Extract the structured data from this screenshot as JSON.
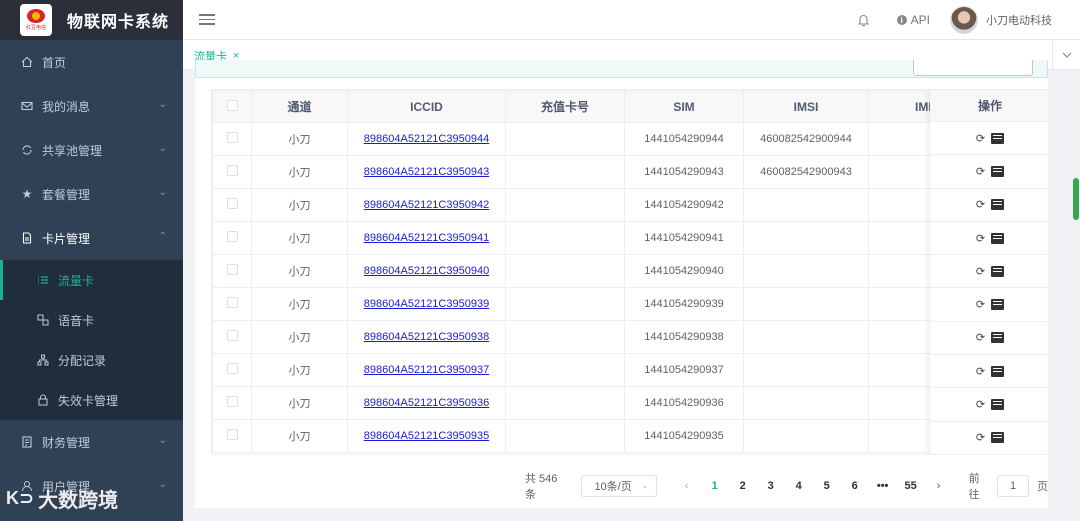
{
  "app": {
    "title": "物联网卡系统",
    "logo_text": "红豆电信"
  },
  "sidebar": {
    "items": [
      {
        "label": "首页",
        "icon": "home-icon"
      },
      {
        "label": "我的消息",
        "icon": "mail-icon"
      },
      {
        "label": "共享池管理",
        "icon": "sync-icon"
      },
      {
        "label": "套餐管理",
        "icon": "star-icon"
      },
      {
        "label": "卡片管理",
        "icon": "document-icon"
      }
    ],
    "sub_items": [
      {
        "label": "流量卡",
        "icon": "list-icon"
      },
      {
        "label": "语音卡",
        "icon": "voice-card-icon"
      },
      {
        "label": "分配记录",
        "icon": "tree-icon"
      },
      {
        "label": "失效卡管理",
        "icon": "lock-icon"
      }
    ],
    "bottom_items": [
      {
        "label": "财务管理",
        "icon": "finance-icon"
      },
      {
        "label": "用户管理",
        "icon": "user-icon"
      }
    ]
  },
  "watermark": "大数跨境",
  "header": {
    "api_label": "API",
    "username": "小刀电动科技"
  },
  "tabs": [
    {
      "label": "流量卡",
      "close": "×"
    }
  ],
  "table": {
    "columns": [
      "通道",
      "ICCID",
      "充值卡号",
      "SIM",
      "IMSI",
      "IMI",
      "操作"
    ],
    "rows": [
      {
        "channel": "小刀",
        "iccid": "898604A52121C3950944",
        "recharge": "",
        "sim": "1441054290944",
        "imsi": "460082542900944"
      },
      {
        "channel": "小刀",
        "iccid": "898604A52121C3950943",
        "recharge": "",
        "sim": "1441054290943",
        "imsi": "460082542900943"
      },
      {
        "channel": "小刀",
        "iccid": "898604A52121C3950942",
        "recharge": "",
        "sim": "1441054290942",
        "imsi": ""
      },
      {
        "channel": "小刀",
        "iccid": "898604A52121C3950941",
        "recharge": "",
        "sim": "1441054290941",
        "imsi": ""
      },
      {
        "channel": "小刀",
        "iccid": "898604A52121C3950940",
        "recharge": "",
        "sim": "1441054290940",
        "imsi": ""
      },
      {
        "channel": "小刀",
        "iccid": "898604A52121C3950939",
        "recharge": "",
        "sim": "1441054290939",
        "imsi": ""
      },
      {
        "channel": "小刀",
        "iccid": "898604A52121C3950938",
        "recharge": "",
        "sim": "1441054290938",
        "imsi": ""
      },
      {
        "channel": "小刀",
        "iccid": "898604A52121C3950937",
        "recharge": "",
        "sim": "1441054290937",
        "imsi": ""
      },
      {
        "channel": "小刀",
        "iccid": "898604A52121C3950936",
        "recharge": "",
        "sim": "1441054290936",
        "imsi": ""
      },
      {
        "channel": "小刀",
        "iccid": "898604A52121C3950935",
        "recharge": "",
        "sim": "1441054290935",
        "imsi": ""
      }
    ]
  },
  "pagination": {
    "total": "共 546 条",
    "page_size": "10条/页",
    "pages": [
      "1",
      "2",
      "3",
      "4",
      "5",
      "6",
      "•••",
      "55"
    ],
    "current": "1",
    "prev": "‹",
    "next": "›",
    "goto_prefix": "前往",
    "goto_value": "1",
    "goto_suffix": "页"
  },
  "colors": {
    "sidebar_bg": "#304156",
    "accent": "#1ab394",
    "link": "#1c1cd1"
  }
}
